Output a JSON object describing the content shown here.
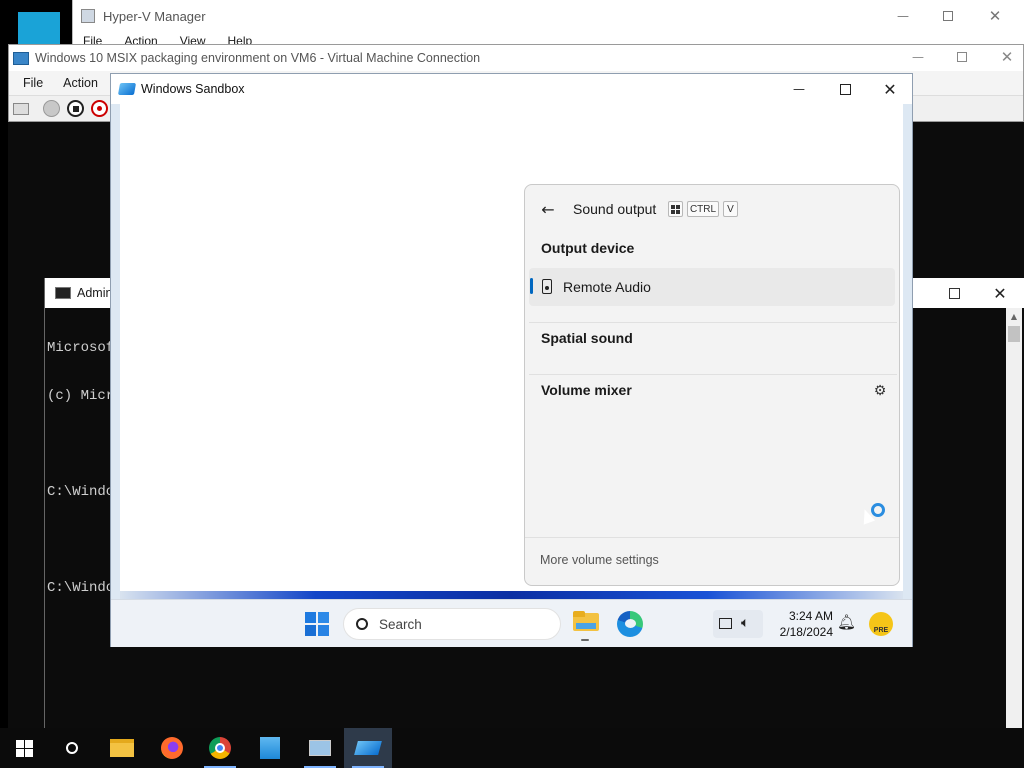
{
  "hyperv": {
    "title": "Hyper-V Manager",
    "menu": [
      "File",
      "Action",
      "View",
      "Help"
    ]
  },
  "vmconnect": {
    "title": "Windows 10 MSIX packaging environment on VM6 - Virtual Machine Connection",
    "menu": [
      "File",
      "Action"
    ]
  },
  "cmd": {
    "title": "Admin",
    "lines": [
      "Microsof",
      "(c) Micr",
      "",
      "C:\\Windo",
      "",
      "C:\\Windo"
    ]
  },
  "sandbox": {
    "title": "Windows Sandbox"
  },
  "sound_panel": {
    "header": "Sound output",
    "shortcut_keys": [
      "CTRL",
      "V"
    ],
    "output_device_heading": "Output device",
    "device_name": "Remote Audio",
    "spatial_heading": "Spatial sound",
    "mixer_heading": "Volume mixer",
    "footer_link": "More volume settings",
    "accent": "#0067c0"
  },
  "sandbox_taskbar": {
    "search_placeholder": "Search",
    "time": "3:24 AM",
    "date": "2/18/2024"
  },
  "colors": {
    "hyperv_tile": "#1aa3d7",
    "sandbox_accent": "#0078d4"
  }
}
